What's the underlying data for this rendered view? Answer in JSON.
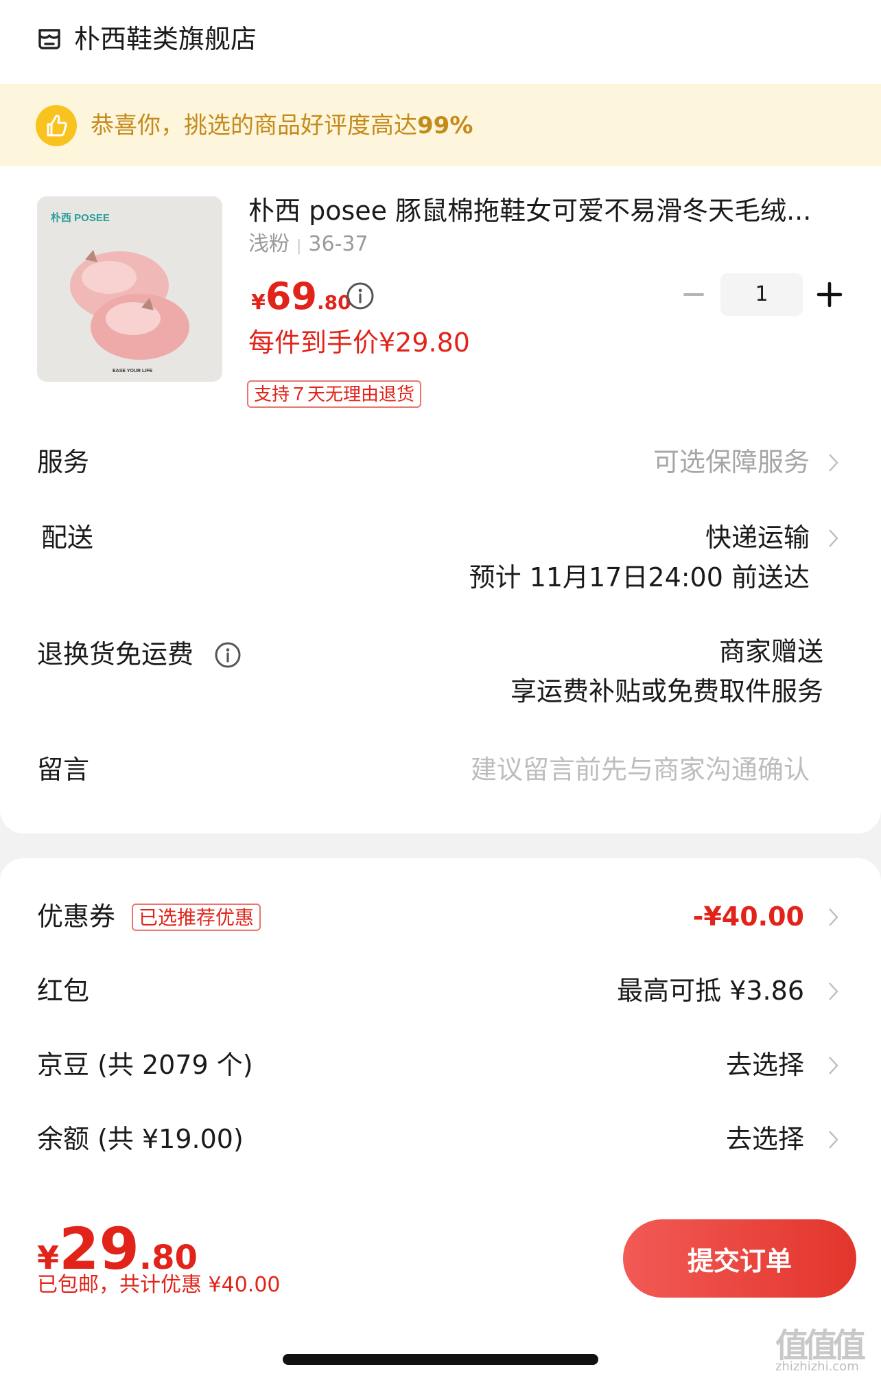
{
  "store": {
    "name": "朴西鞋类旗舰店"
  },
  "banner": {
    "text": "恭喜你，挑选的商品好评度高达",
    "percent": "99%"
  },
  "product": {
    "title": "朴西 posee 豚鼠棉拖鞋女可爱不易滑冬天毛绒...",
    "color": "浅粉",
    "size": "36-37",
    "price_yen": "¥",
    "price_int": "69",
    "price_dec": ".80",
    "per_item_price": "每件到手价¥29.80",
    "return_tag": "支持７天无理由退货",
    "image_brand": "朴西 POSEE",
    "image_slogan": "EASE YOUR LIFE",
    "quantity": "1"
  },
  "rows": {
    "service": {
      "label": "服务",
      "value": "可选保障服务"
    },
    "shipping": {
      "label": "配送",
      "value": "快递运输",
      "eta": "预计 11月17日24:00 前送达"
    },
    "return_shipping": {
      "label": "退换货免运费",
      "value1": "商家赠送",
      "value2": "享运费补贴或免费取件服务"
    },
    "message": {
      "label": "留言",
      "placeholder": "建议留言前先与商家沟通确认"
    },
    "coupon": {
      "label": "优惠券",
      "tag": "已选推荐优惠",
      "value": "-¥40.00"
    },
    "redpacket": {
      "label": "红包",
      "value": "最高可抵 ¥3.86"
    },
    "jingdou": {
      "label": "京豆 (共 2079 个)",
      "value": "去选择"
    },
    "balance": {
      "label": "余额 (共 ¥19.00)",
      "value": "去选择"
    }
  },
  "footer": {
    "total_yen": "¥",
    "total_int": "29",
    "total_dec": ".80",
    "summary": "已包邮，共计优惠 ¥40.00",
    "submit_label": "提交订单"
  },
  "watermark": {
    "logo": "值值值",
    "url": "zhizhizhi.com"
  },
  "colors": {
    "accent": "#e2231a",
    "banner_bg": "#fdf6dd",
    "banner_text": "#c58a1c",
    "badge": "#f9c31f"
  }
}
